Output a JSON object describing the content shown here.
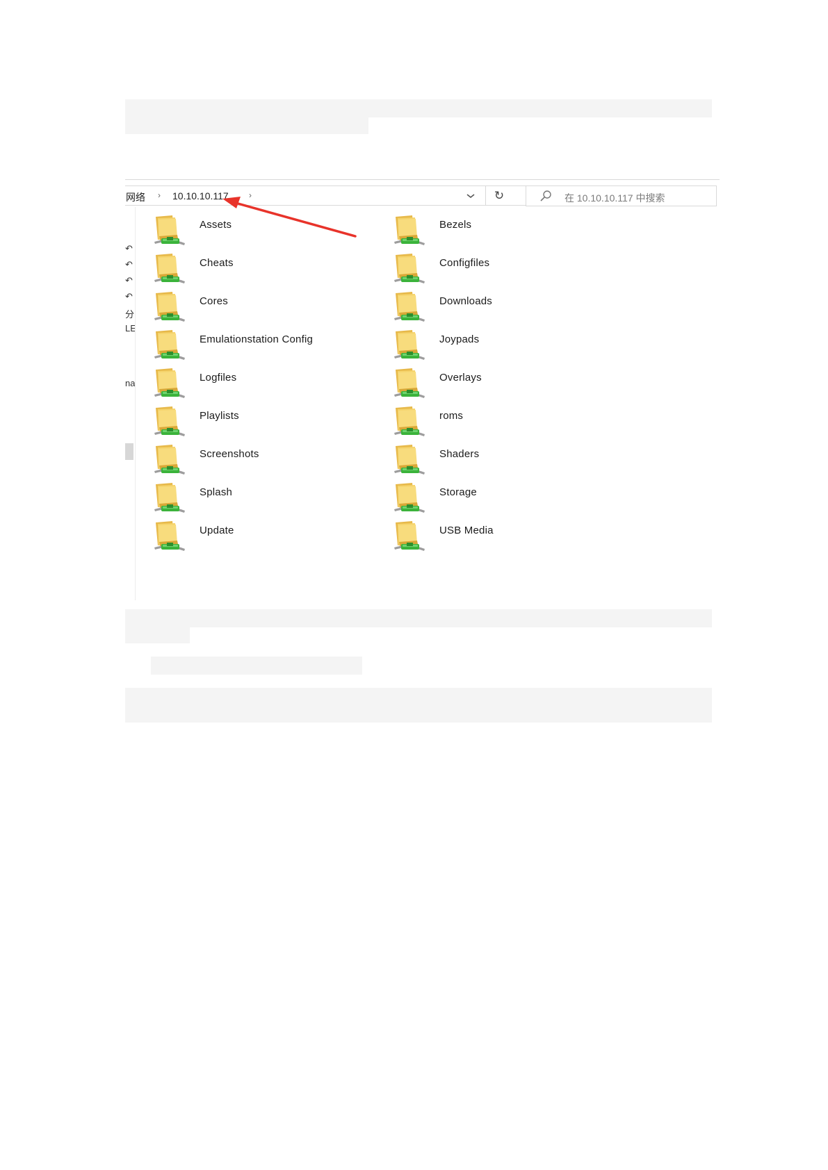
{
  "address_bar": {
    "breadcrumbs": [
      "网络",
      "10.10.10.117"
    ],
    "separator": "›",
    "dropdown_icon": "chevron-down-icon",
    "refresh_glyph": "↻"
  },
  "search": {
    "placeholder": "在 10.10.10.117 中搜索",
    "icon": "search-icon"
  },
  "nav_pane": {
    "fragments": [
      "↶",
      "↶",
      "↶",
      "↶",
      "分",
      "LE",
      "na"
    ]
  },
  "folders": {
    "left": [
      "Assets",
      "Cheats",
      "Cores",
      "Emulationstation Config",
      "Logfiles",
      "Playlists",
      "Screenshots",
      "Splash",
      "Update"
    ],
    "right": [
      "Bezels",
      "Configfiles",
      "Downloads",
      "Joypads",
      "Overlays",
      "roms",
      "Shaders",
      "Storage",
      "USB Media"
    ]
  },
  "colors": {
    "annotation_arrow": "#e8332a",
    "folder_yellow": "#f5d36b",
    "network_green": "#3bb33b"
  }
}
